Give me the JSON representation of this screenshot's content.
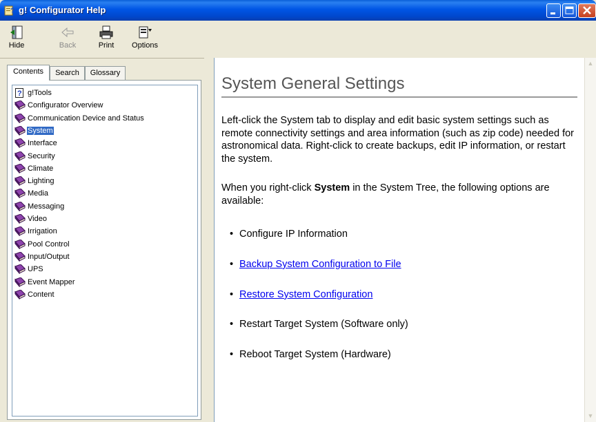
{
  "window": {
    "title": "g! Configurator Help"
  },
  "toolbar": {
    "buttons": [
      {
        "label": "Hide",
        "enabled": true
      },
      {
        "label": "Back",
        "enabled": false
      },
      {
        "label": "Print",
        "enabled": true
      },
      {
        "label": "Options",
        "enabled": true
      }
    ]
  },
  "nav": {
    "tabs": [
      "Contents",
      "Search",
      "Glossary"
    ],
    "active_tab": "Contents",
    "tree": [
      {
        "label": "g!Tools",
        "icon": "help-page-icon"
      },
      {
        "label": "Configurator Overview",
        "icon": "book-icon"
      },
      {
        "label": "Communication Device and Status",
        "icon": "book-icon"
      },
      {
        "label": "System",
        "icon": "book-icon",
        "selected": true
      },
      {
        "label": "Interface",
        "icon": "book-icon"
      },
      {
        "label": "Security",
        "icon": "book-icon"
      },
      {
        "label": "Climate",
        "icon": "book-icon"
      },
      {
        "label": "Lighting",
        "icon": "book-icon"
      },
      {
        "label": "Media",
        "icon": "book-icon"
      },
      {
        "label": "Messaging",
        "icon": "book-icon"
      },
      {
        "label": "Video",
        "icon": "book-icon"
      },
      {
        "label": "Irrigation",
        "icon": "book-icon"
      },
      {
        "label": "Pool Control",
        "icon": "book-icon"
      },
      {
        "label": "Input/Output",
        "icon": "book-icon"
      },
      {
        "label": "UPS",
        "icon": "book-icon"
      },
      {
        "label": "Event Mapper",
        "icon": "book-icon"
      },
      {
        "label": "Content",
        "icon": "book-icon"
      }
    ]
  },
  "page": {
    "heading": "System General Settings",
    "intro": "Left-click the System tab to display and edit basic system settings such as remote connectivity settings and area information (such as zip code) needed for astronomical data. Right-click to create backups, edit IP information, or restart the system.",
    "p2_before": "When you right-click ",
    "p2_bold": "System",
    "p2_after": " in the System Tree, the following options are available:",
    "options": [
      {
        "text": "Configure IP Information",
        "link": false
      },
      {
        "text": "Backup System Configuration to File",
        "link": true
      },
      {
        "text": "Restore System Configuration",
        "link": true
      },
      {
        "text": "Restart Target System (Software only)",
        "link": false
      },
      {
        "text": "Reboot Target System (Hardware)",
        "link": false
      }
    ]
  },
  "colors": {
    "titlebar": "#0055E5",
    "selection": "#316AC5",
    "link": "#0000EE",
    "book": "#6B2A8C"
  }
}
